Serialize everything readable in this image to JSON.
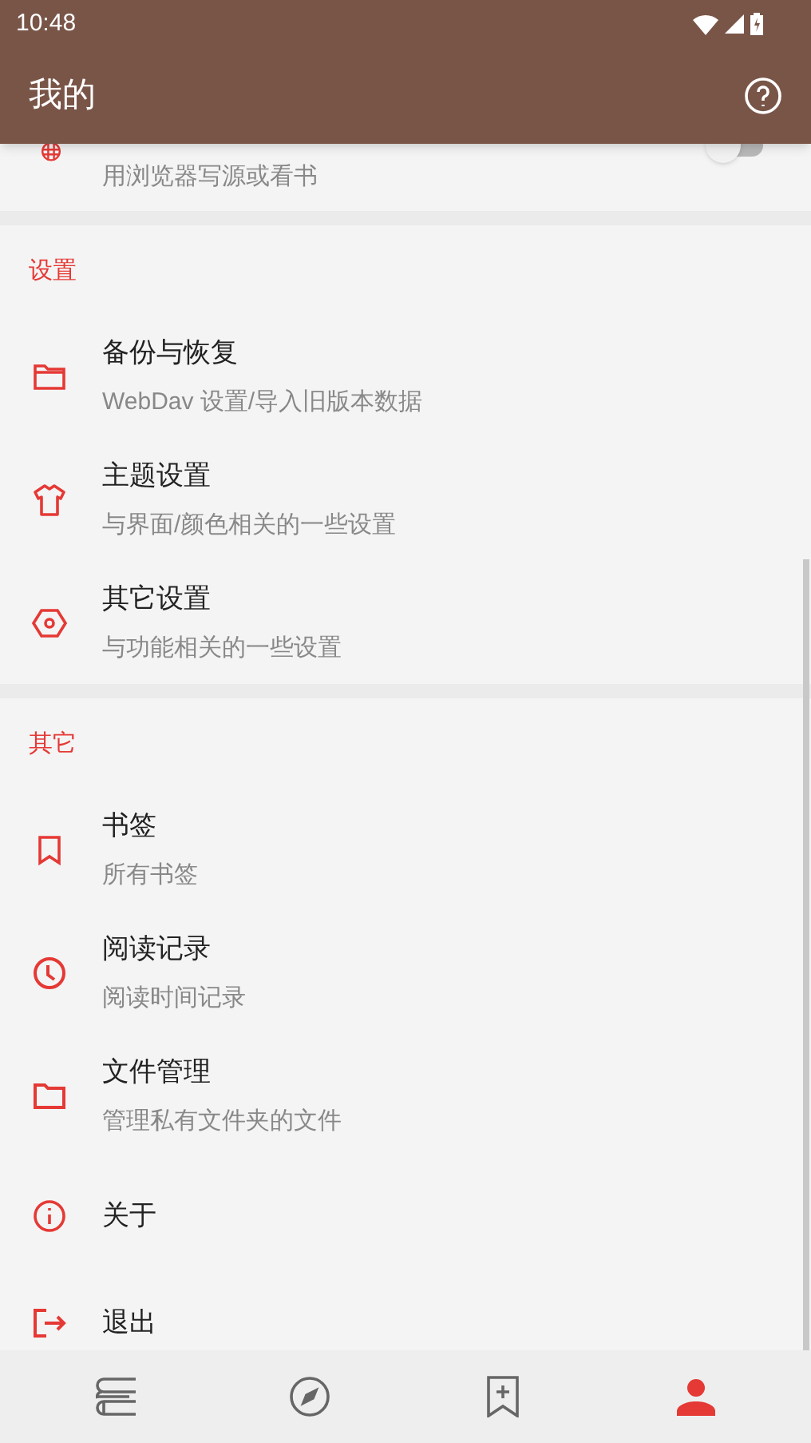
{
  "status_bar": {
    "time": "10:48"
  },
  "app_bar": {
    "title": "我的"
  },
  "partial_item": {
    "subtitle": "用浏览器写源或看书",
    "toggle": {
      "on": false
    }
  },
  "sections": [
    {
      "header": "设置",
      "items": [
        {
          "title": "备份与恢复",
          "subtitle": "WebDav 设置/导入旧版本数据"
        },
        {
          "title": "主题设置",
          "subtitle": "与界面/颜色相关的一些设置"
        },
        {
          "title": "其它设置",
          "subtitle": "与功能相关的一些设置"
        }
      ]
    },
    {
      "header": "其它",
      "items": [
        {
          "title": "书签",
          "subtitle": "所有书签"
        },
        {
          "title": "阅读记录",
          "subtitle": "阅读时间记录"
        },
        {
          "title": "文件管理",
          "subtitle": "管理私有文件夹的文件"
        },
        {
          "title": "关于"
        },
        {
          "title": "退出"
        }
      ]
    }
  ],
  "bottom_nav": [
    {
      "selected": false
    },
    {
      "selected": false
    },
    {
      "selected": false
    },
    {
      "selected": true
    }
  ]
}
